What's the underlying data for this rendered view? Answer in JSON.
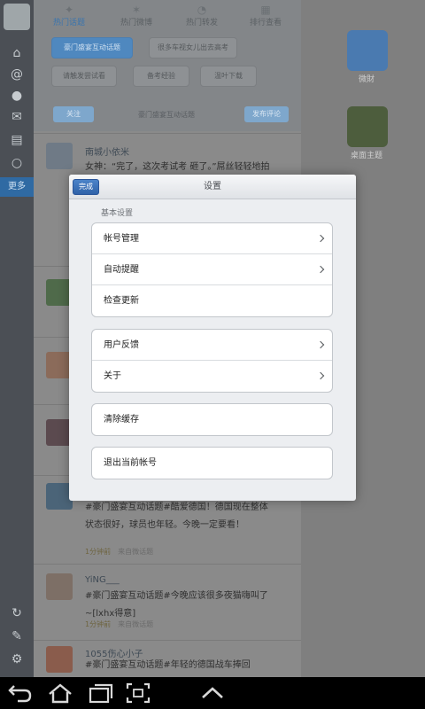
{
  "background_app": {
    "top_tabs": [
      {
        "label": "热门话题",
        "active": true
      },
      {
        "label": "热门微博",
        "active": false
      },
      {
        "label": "热门转发",
        "active": false
      },
      {
        "label": "排行查看",
        "active": false
      }
    ],
    "topic_chips": [
      "豪门盛宴互动话题",
      "很多车视女儿出去高考",
      "请触发尝试看",
      "备考经验",
      "温叶下载"
    ],
    "topic_bar": {
      "left": "关注",
      "center": "豪门盛宴互动话题",
      "right": "发布评论"
    },
    "rail_active_label": "更多",
    "feed": [
      {
        "name": "南城小依米",
        "text": "女神：“完了，这次考试考 砸了。”屌丝轻轻地拍了拍女神的肩说：“没关系，我"
      },
      {
        "name": "",
        "text": ""
      },
      {
        "name": "",
        "text": ""
      },
      {
        "name": "",
        "text": ""
      },
      {
        "name": "",
        "text": "#豪门盛宴互动话题#酷爱德国！德国现在整体状态很好，球员也年轻。今晚一定要看！",
        "meta_time": "1分钟前",
        "meta_source": "来自微话题"
      },
      {
        "name": "YiNG___",
        "text": "#豪门盛宴互动话题#今晚应该很多夜猫嗨叫了~[lxhx得意]",
        "meta_time": "1分钟前",
        "meta_source": "来自微话题"
      },
      {
        "name": "1055伤心小子",
        "text": "#豪门盛宴互动话题#年轻的德国战车捧回"
      }
    ],
    "desktop_icons": [
      {
        "label": "微財"
      },
      {
        "label": "桌面主题"
      }
    ]
  },
  "settings": {
    "done_label": "完成",
    "title": "设置",
    "section_title": "基本设置",
    "groups": [
      {
        "rows": [
          {
            "label": "帐号管理",
            "chevron": true
          },
          {
            "label": "自动提醒",
            "chevron": true
          },
          {
            "label": "检查更新",
            "chevron": false
          }
        ]
      },
      {
        "rows": [
          {
            "label": "用户反馈",
            "chevron": true
          },
          {
            "label": "关于",
            "chevron": true
          }
        ]
      },
      {
        "rows": [
          {
            "label": "清除缓存",
            "chevron": false
          }
        ]
      },
      {
        "rows": [
          {
            "label": "退出当前帐号",
            "chevron": false
          }
        ]
      }
    ]
  },
  "nav_bar": {
    "buttons": [
      "back-icon",
      "home-icon",
      "recent-apps-icon",
      "screenshot-icon",
      "up-arrow-icon"
    ]
  },
  "colors": {
    "accent": "#2f62a8",
    "modal_bg": "#eceef1",
    "dim_overlay": "#7f7f7f"
  }
}
